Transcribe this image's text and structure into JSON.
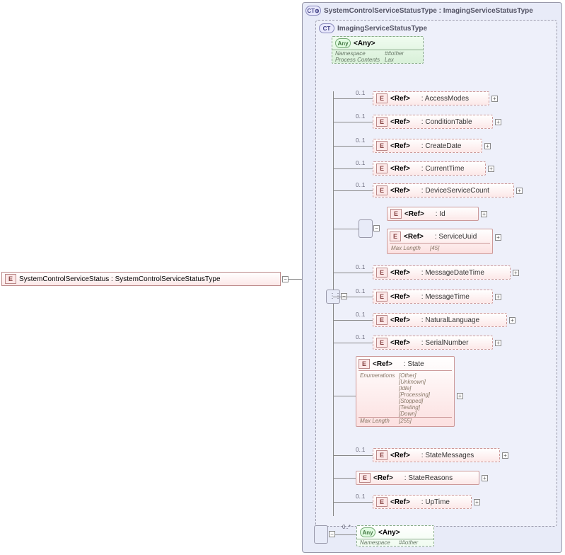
{
  "root": {
    "label": "SystemControlServiceStatus : SystemControlServiceStatusType"
  },
  "outerType": {
    "label": "SystemControlServiceStatusType : ImagingServiceStatusType"
  },
  "innerType": {
    "label": "ImagingServiceStatusType"
  },
  "anyTop": {
    "label": "<Any>",
    "rows": [
      {
        "key": "Namespace",
        "val": "##other"
      },
      {
        "key": "Process Contents",
        "val": "Lax"
      }
    ]
  },
  "refs": {
    "accessModes": {
      "label": "<Ref>",
      "type": ": AccessModes",
      "card": "0..1"
    },
    "conditionTable": {
      "label": "<Ref>",
      "type": ": ConditionTable",
      "card": "0..1"
    },
    "createDate": {
      "label": "<Ref>",
      "type": ": CreateDate",
      "card": "0..1"
    },
    "currentTime": {
      "label": "<Ref>",
      "type": ": CurrentTime",
      "card": "0..1"
    },
    "deviceServiceCount": {
      "label": "<Ref>",
      "type": ": DeviceServiceCount",
      "card": "0..1"
    },
    "id": {
      "label": "<Ref>",
      "type": ": Id"
    },
    "serviceUuid": {
      "label": "<Ref>",
      "type": ": ServiceUuid",
      "maxLength": "[45]"
    },
    "messageDateTime": {
      "label": "<Ref>",
      "type": ": MessageDateTime",
      "card": "0..1"
    },
    "messageTime": {
      "label": "<Ref>",
      "type": ": MessageTime",
      "card": "0..1"
    },
    "naturalLanguage": {
      "label": "<Ref>",
      "type": ": NaturalLanguage",
      "card": "0..1"
    },
    "serialNumber": {
      "label": "<Ref>",
      "type": ": SerialNumber",
      "card": "0..1"
    },
    "state": {
      "label": "<Ref>",
      "type": ": State",
      "enumerations": [
        "[Other]",
        "[Unknown]",
        "[Idle]",
        "[Processing]",
        "[Stopped]",
        "[Testing]",
        "[Down]"
      ],
      "maxLength": "[255]"
    },
    "stateMessages": {
      "label": "<Ref>",
      "type": ": StateMessages",
      "card": "0..1"
    },
    "stateReasons": {
      "label": "<Ref>",
      "type": ": StateReasons"
    },
    "upTime": {
      "label": "<Ref>",
      "type": ": UpTime",
      "card": "0..1"
    }
  },
  "anyBottom": {
    "label": "<Any>",
    "card": "0..*",
    "rows": [
      {
        "key": "Namespace",
        "val": "##other"
      }
    ]
  },
  "labels": {
    "maxLength": "Max Length",
    "enumerations": "Enumerations"
  }
}
